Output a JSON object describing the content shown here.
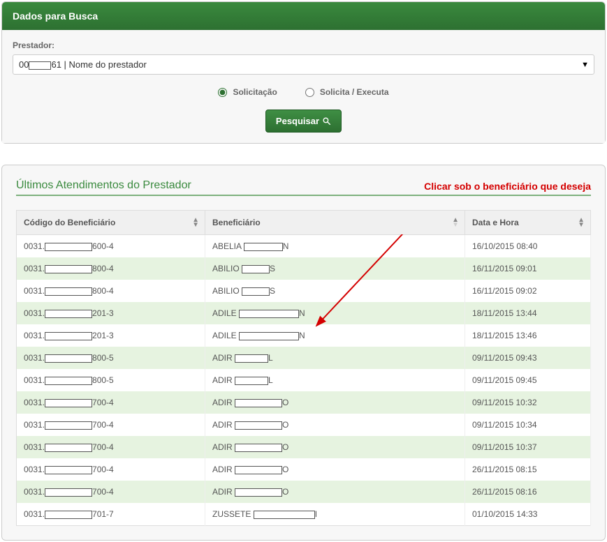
{
  "search_panel": {
    "title": "Dados para Busca",
    "prestador_label": "Prestador:",
    "prestador_value_prefix": "00",
    "prestador_value_suffix": "61 | Nome do prestador",
    "radio_solicitacao": "Solicitação",
    "radio_solicita_executa": "Solicita / Executa",
    "search_button": "Pesquisar"
  },
  "results": {
    "title": "Últimos Atendimentos do Prestador",
    "annotation": "Clicar sob o beneficiário que deseja",
    "columns": {
      "codigo": "Código do Beneficiário",
      "beneficiario": "Beneficiário",
      "data": "Data e Hora"
    },
    "rows": [
      {
        "codigo_prefix": "0031.",
        "codigo_suffix": "600-4",
        "nome_prefix": "ABELIA",
        "nome_suffix": "N",
        "data": "16/10/2015 08:40",
        "mask_cod_w": 68,
        "mask_nome_w": 56
      },
      {
        "codigo_prefix": "0031.",
        "codigo_suffix": "800-4",
        "nome_prefix": "ABILIO",
        "nome_suffix": "S",
        "data": "16/11/2015 09:01",
        "mask_cod_w": 68,
        "mask_nome_w": 40
      },
      {
        "codigo_prefix": "0031.",
        "codigo_suffix": "800-4",
        "nome_prefix": "ABILIO",
        "nome_suffix": "S",
        "data": "16/11/2015 09:02",
        "mask_cod_w": 68,
        "mask_nome_w": 40
      },
      {
        "codigo_prefix": "0031.",
        "codigo_suffix": "201-3",
        "nome_prefix": "ADILE",
        "nome_suffix": "N",
        "data": "18/11/2015 13:44",
        "mask_cod_w": 68,
        "mask_nome_w": 86
      },
      {
        "codigo_prefix": "0031.",
        "codigo_suffix": "201-3",
        "nome_prefix": "ADILE",
        "nome_suffix": "N",
        "data": "18/11/2015 13:46",
        "mask_cod_w": 68,
        "mask_nome_w": 86
      },
      {
        "codigo_prefix": "0031.",
        "codigo_suffix": "800-5",
        "nome_prefix": "ADIR",
        "nome_suffix": "L",
        "data": "09/11/2015 09:43",
        "mask_cod_w": 68,
        "mask_nome_w": 48
      },
      {
        "codigo_prefix": "0031.",
        "codigo_suffix": "800-5",
        "nome_prefix": "ADIR",
        "nome_suffix": "L",
        "data": "09/11/2015 09:45",
        "mask_cod_w": 68,
        "mask_nome_w": 48
      },
      {
        "codigo_prefix": "0031.",
        "codigo_suffix": "700-4",
        "nome_prefix": "ADIR",
        "nome_suffix": "O",
        "data": "09/11/2015 10:32",
        "mask_cod_w": 68,
        "mask_nome_w": 68
      },
      {
        "codigo_prefix": "0031.",
        "codigo_suffix": "700-4",
        "nome_prefix": "ADIR",
        "nome_suffix": "O",
        "data": "09/11/2015 10:34",
        "mask_cod_w": 68,
        "mask_nome_w": 68
      },
      {
        "codigo_prefix": "0031.",
        "codigo_suffix": "700-4",
        "nome_prefix": "ADIR",
        "nome_suffix": "O",
        "data": "09/11/2015 10:37",
        "mask_cod_w": 68,
        "mask_nome_w": 68
      },
      {
        "codigo_prefix": "0031.",
        "codigo_suffix": "700-4",
        "nome_prefix": "ADIR",
        "nome_suffix": "O",
        "data": "26/11/2015 08:15",
        "mask_cod_w": 68,
        "mask_nome_w": 68
      },
      {
        "codigo_prefix": "0031.",
        "codigo_suffix": "700-4",
        "nome_prefix": "ADIR",
        "nome_suffix": "O",
        "data": "26/11/2015 08:16",
        "mask_cod_w": 68,
        "mask_nome_w": 68
      },
      {
        "codigo_prefix": "0031.",
        "codigo_suffix": "701-7",
        "nome_prefix": "ZUSSETE",
        "nome_suffix": "I",
        "data": "01/10/2015 14:33",
        "mask_cod_w": 68,
        "mask_nome_w": 88
      }
    ]
  }
}
